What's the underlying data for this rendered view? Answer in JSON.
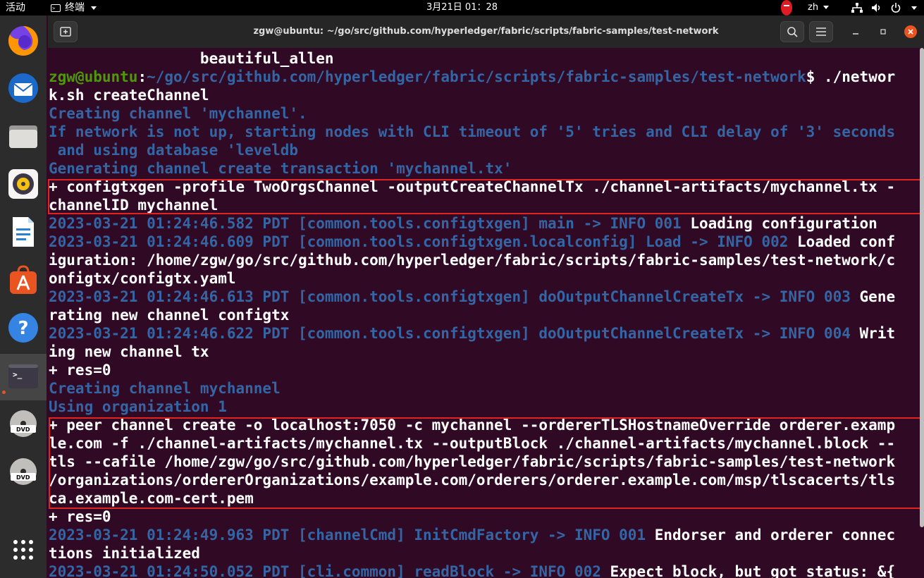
{
  "topbar": {
    "activities": "活动",
    "app_menu": "终端",
    "clock": "3月21日 01：28",
    "language": "zh"
  },
  "dock": {
    "apps": [
      "firefox-icon",
      "thunderbird-icon",
      "files-icon",
      "rhythmbox-icon",
      "writer-icon",
      "software-icon",
      "help-icon",
      "terminal-icon",
      "dvd-icon",
      "dvd-icon",
      "show-apps-icon"
    ],
    "dvd_label": "DVD"
  },
  "window": {
    "title": "zgw@ubuntu: ~/go/src/github.com/hyperledger/fabric/scripts/fabric-samples/test-network"
  },
  "terminal": {
    "lines": [
      [
        {
          "t": "                 beautiful_allen",
          "c": "white"
        }
      ],
      [
        {
          "t": "zgw@ubuntu",
          "c": "green"
        },
        {
          "t": ":",
          "c": "white"
        },
        {
          "t": "~/go/src/github.com/hyperledger/fabric/scripts/fabric-samples/test-network",
          "c": "blue"
        },
        {
          "t": "$ ./networ",
          "c": "white"
        }
      ],
      [
        {
          "t": "k.sh createChannel",
          "c": "white"
        }
      ],
      [
        {
          "t": "Creating channel 'mychannel'.",
          "c": "blue"
        }
      ],
      [
        {
          "t": "If network is not up, starting nodes with CLI timeout of '5' tries and CLI delay of '3' seconds",
          "c": "blue"
        }
      ],
      [
        {
          "t": " and using database 'leveldb",
          "c": "blue"
        }
      ],
      [
        {
          "t": "Generating channel create transaction 'mychannel.tx'",
          "c": "blue"
        }
      ],
      [
        {
          "t": "+ configtxgen -profile TwoOrgsChannel -outputCreateChannelTx ./channel-artifacts/mychannel.tx -",
          "c": "white"
        }
      ],
      [
        {
          "t": "channelID mychannel",
          "c": "white"
        }
      ],
      [
        {
          "t": "2023-03-21 01:24:46.582 PDT [common.tools.configtxgen] main -> INFO 001 ",
          "c": "blue"
        },
        {
          "t": "Loading configuration",
          "c": "white"
        }
      ],
      [
        {
          "t": "2023-03-21 01:24:46.609 PDT [common.tools.configtxgen.localconfig] Load -> INFO 002 ",
          "c": "blue"
        },
        {
          "t": "Loaded conf",
          "c": "white"
        }
      ],
      [
        {
          "t": "iguration: /home/zgw/go/src/github.com/hyperledger/fabric/scripts/fabric-samples/test-network/c",
          "c": "white"
        }
      ],
      [
        {
          "t": "onfigtx/configtx.yaml",
          "c": "white"
        }
      ],
      [
        {
          "t": "2023-03-21 01:24:46.613 PDT [common.tools.configtxgen] doOutputChannelCreateTx -> INFO 003 ",
          "c": "blue"
        },
        {
          "t": "Gene",
          "c": "white"
        }
      ],
      [
        {
          "t": "rating new channel configtx",
          "c": "white"
        }
      ],
      [
        {
          "t": "2023-03-21 01:24:46.622 PDT [common.tools.configtxgen] doOutputChannelCreateTx -> INFO 004 ",
          "c": "blue"
        },
        {
          "t": "Writ",
          "c": "white"
        }
      ],
      [
        {
          "t": "ing new channel tx",
          "c": "white"
        }
      ],
      [
        {
          "t": "+ res=0",
          "c": "white"
        }
      ],
      [
        {
          "t": "Creating channel mychannel",
          "c": "blue"
        }
      ],
      [
        {
          "t": "Using organization 1",
          "c": "blue"
        }
      ],
      [
        {
          "t": "+ peer channel create -o localhost:7050 -c mychannel --ordererTLSHostnameOverride orderer.examp",
          "c": "white"
        }
      ],
      [
        {
          "t": "le.com -f ./channel-artifacts/mychannel.tx --outputBlock ./channel-artifacts/mychannel.block --",
          "c": "white"
        }
      ],
      [
        {
          "t": "tls --cafile /home/zgw/go/src/github.com/hyperledger/fabric/scripts/fabric-samples/test-network",
          "c": "white"
        }
      ],
      [
        {
          "t": "/organizations/ordererOrganizations/example.com/orderers/orderer.example.com/msp/tlscacerts/tls",
          "c": "white"
        }
      ],
      [
        {
          "t": "ca.example.com-cert.pem",
          "c": "white"
        }
      ],
      [
        {
          "t": "+ res=0",
          "c": "white"
        }
      ],
      [
        {
          "t": "2023-03-21 01:24:49.963 PDT [channelCmd] InitCmdFactory -> INFO 001 ",
          "c": "blue"
        },
        {
          "t": "Endorser and orderer connec",
          "c": "white"
        }
      ],
      [
        {
          "t": "tions initialized",
          "c": "white"
        }
      ],
      [
        {
          "t": "2023-03-21 01:24:50.052 PDT [cli.common] readBlock -> INFO 002 ",
          "c": "blue"
        },
        {
          "t": "Expect block, but got status: &{",
          "c": "white"
        }
      ]
    ]
  },
  "colors": {
    "terminal_bg": "#300a24",
    "prompt_user": "#4e9a06",
    "prompt_path": "#3465a4",
    "log_text": "#3465a4",
    "highlight_box": "#e02424"
  }
}
